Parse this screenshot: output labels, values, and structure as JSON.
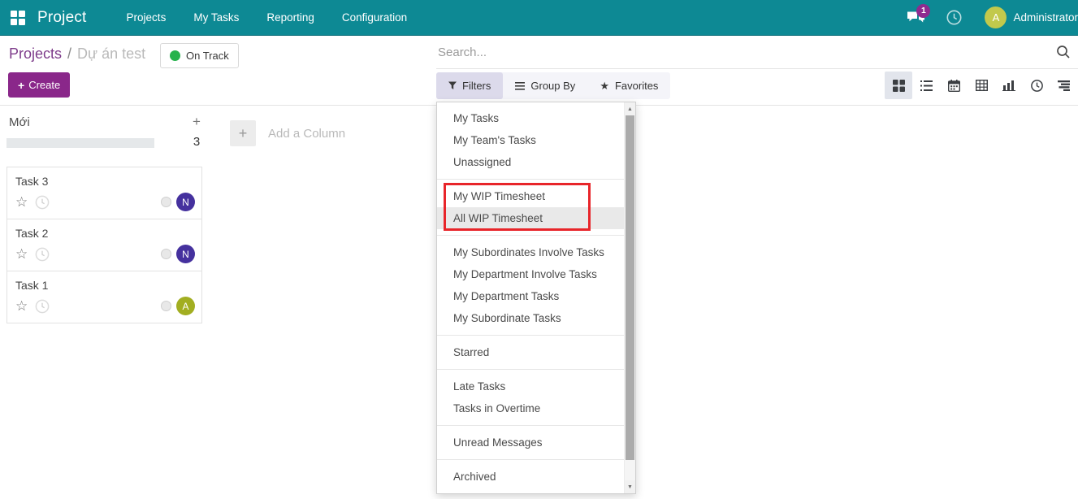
{
  "colors": {
    "navbar_bg": "#0d8994",
    "primary_button": "#8a278a",
    "breadcrumb_link": "#7d3b8a",
    "on_track_green": "#26b24c",
    "message_badge_bg": "#8f2b8f",
    "nav_avatar_bg": "#c2c94c",
    "annotation_red": "#e8252a",
    "highlighted_row_bg": "#e9e9e9"
  },
  "navbar": {
    "app_name": "Project",
    "menu_items": [
      "Projects",
      "My Tasks",
      "Reporting",
      "Configuration"
    ],
    "systray": {
      "message_count": "1",
      "user_initial": "A",
      "user_name": "Administrator"
    }
  },
  "breadcrumb": {
    "parent": "Projects",
    "separator": "/",
    "current": "Dự án test"
  },
  "status_button": "On Track",
  "create_button": "Create",
  "search": {
    "placeholder": "Search..."
  },
  "filter_bar": {
    "filters": "Filters",
    "group_by": "Group By",
    "favorites": "Favorites",
    "active": "Filters"
  },
  "view_switcher": {
    "views": [
      "kanban",
      "list",
      "calendar",
      "pivot",
      "graph",
      "activity",
      "gantt"
    ],
    "active": "kanban"
  },
  "filters_menu": {
    "groups": [
      [
        "My Tasks",
        "My Team's Tasks",
        "Unassigned"
      ],
      [
        "My WIP Timesheet",
        "All WIP Timesheet"
      ],
      [
        "My Subordinates Involve Tasks",
        "My Department Involve Tasks",
        "My Department Tasks",
        "My Subordinate Tasks"
      ],
      [
        "Starred"
      ],
      [
        "Late Tasks",
        "Tasks in Overtime"
      ],
      [
        "Unread Messages"
      ],
      [
        "Archived"
      ]
    ],
    "highlighted_item": "All WIP Timesheet",
    "annotated_items": [
      "My WIP Timesheet",
      "All WIP Timesheet"
    ]
  },
  "kanban": {
    "column_title": "Mới",
    "column_count": "3",
    "add_column": "Add a Column",
    "cards": [
      {
        "title": "Task 3",
        "avatar_initial": "N",
        "avatar_color": "#45319e"
      },
      {
        "title": "Task 2",
        "avatar_initial": "N",
        "avatar_color": "#45319e"
      },
      {
        "title": "Task 1",
        "avatar_initial": "A",
        "avatar_color": "#a2ae21"
      }
    ]
  },
  "icons": {
    "plus": "+",
    "favorites_star": "★",
    "card_star": "☆",
    "scroll_up": "▲",
    "scroll_down": "▼"
  }
}
